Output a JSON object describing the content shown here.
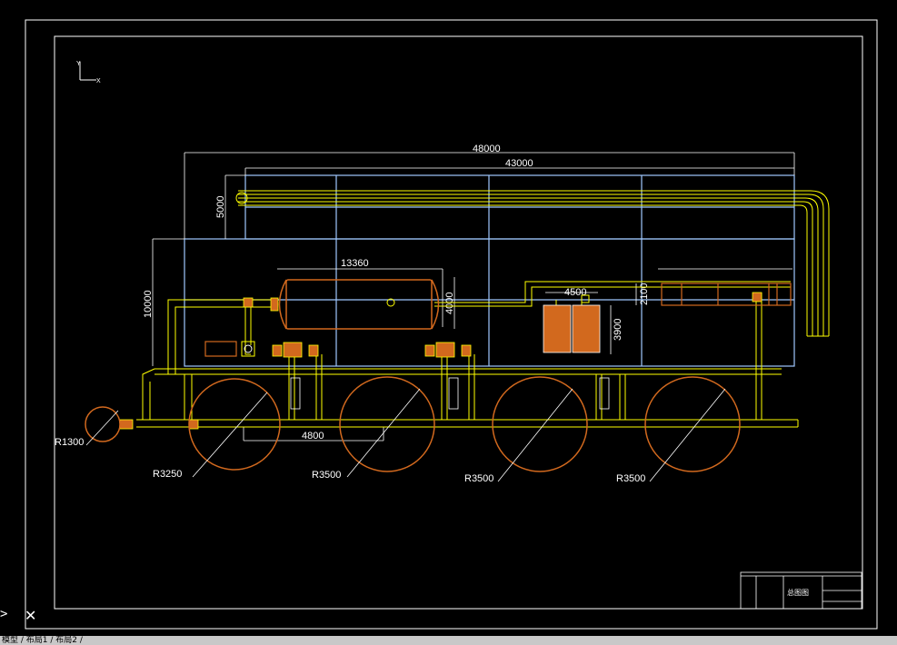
{
  "ucs": {
    "y": "Y",
    "x": "X"
  },
  "dimensions": {
    "overall_length": "48000",
    "frame_length": "43000",
    "upper_height": "5000",
    "total_height": "10000",
    "tank_length": "13360",
    "tank_diameter": "4000",
    "box_width": "4500",
    "box_height": "3900",
    "right_height": "2100",
    "cell_spacing": "4800",
    "r_small": "R1300",
    "r_cell1": "R3250",
    "r_cell2": "R3500",
    "r_cell3": "R3500",
    "r_cell4": "R3500"
  },
  "title_block": {
    "name": "总图图"
  },
  "bottom_tabs": "模型 / 布局1 / 布局2 /",
  "command_prompt": ">",
  "colors": {
    "pipe": "#ffff00",
    "frame": "#9fc8ff",
    "vessel": "#d2691e",
    "dim": "#ffffff"
  }
}
